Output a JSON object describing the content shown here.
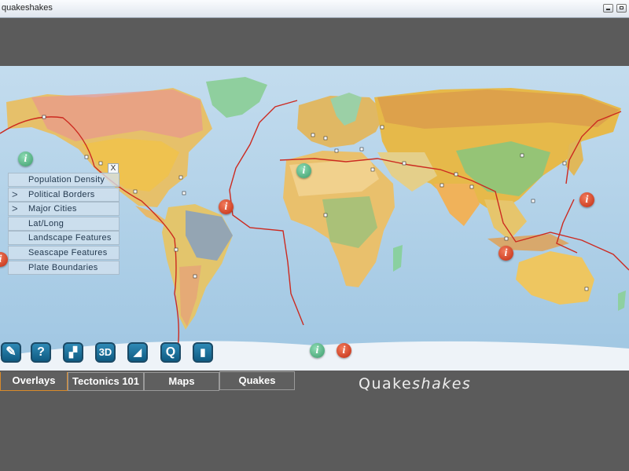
{
  "window": {
    "title": "quakeshakes"
  },
  "overlays": {
    "close_label": "X",
    "items": [
      {
        "label": "Population Density",
        "arrow": ""
      },
      {
        "label": "Political Borders",
        "arrow": ">"
      },
      {
        "label": "Major Cities",
        "arrow": ">"
      },
      {
        "label": "Lat/Long",
        "arrow": ""
      },
      {
        "label": "Landscape Features",
        "arrow": ""
      },
      {
        "label": "Seascape Features",
        "arrow": ""
      },
      {
        "label": "Plate Boundaries",
        "arrow": ""
      }
    ]
  },
  "toolbar": {
    "icons": [
      {
        "name": "compass-icon",
        "glyph": "✎"
      },
      {
        "name": "help-icon",
        "glyph": "?"
      },
      {
        "name": "comment-icon",
        "glyph": "▞"
      },
      {
        "name": "3d-icon",
        "glyph": "3D"
      },
      {
        "name": "rss-icon",
        "glyph": "◢"
      },
      {
        "name": "magnify-icon",
        "glyph": "Q"
      },
      {
        "name": "chart-icon",
        "glyph": "▮"
      }
    ]
  },
  "markers": {
    "info_glyph": "i"
  },
  "tabs": [
    {
      "label": "Overlays",
      "active": true
    },
    {
      "label": "Tectonics 101",
      "active": false
    },
    {
      "label": "Maps",
      "active": false
    },
    {
      "label": "Quakes",
      "active": false
    }
  ],
  "brand": {
    "prefix": "Quake",
    "suffix": "shakes"
  },
  "colors": {
    "plate_boundary": "#cc2a20",
    "info_green": "#3a9a6a",
    "info_red": "#c02a10",
    "active_tab": "#d98a2a"
  }
}
